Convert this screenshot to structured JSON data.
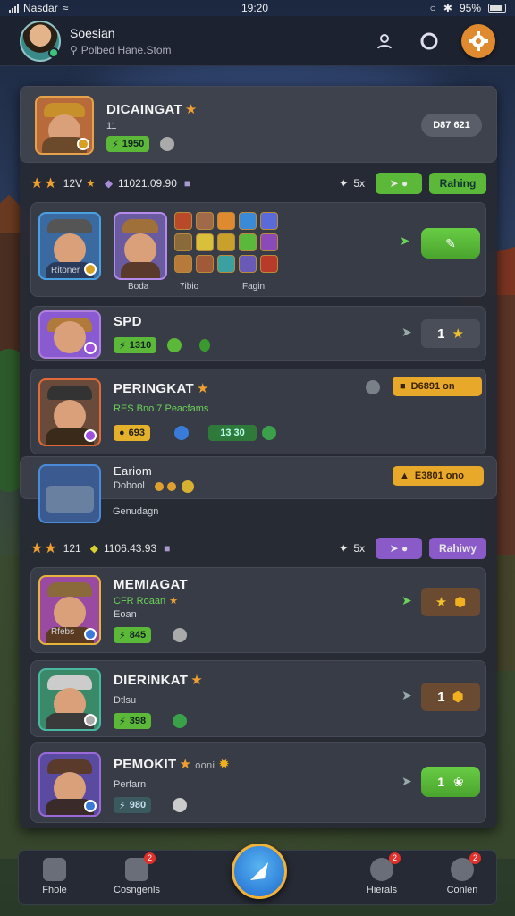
{
  "status_bar": {
    "carrier": "Nasdar",
    "time": "19:20",
    "battery": "95%"
  },
  "header": {
    "player_name": "Soesian",
    "player_sub": "Polbed Hane.Stom"
  },
  "featured": {
    "name": "DICAINGAT",
    "level": "11",
    "chip_value": "1950",
    "button_label": "D87 621"
  },
  "group1": {
    "level": "12V",
    "score": "11021.09.90",
    "rank_label": "5x",
    "action_label": "Rahing"
  },
  "team_card": {
    "hero_label": "Ritoner",
    "col_labels": [
      "Boda",
      "7ibio",
      "Fagin"
    ]
  },
  "rows": [
    {
      "name": "SPD",
      "chip_value": "1310",
      "button_count": "1"
    },
    {
      "name": "PERINGKAT",
      "sub": "RES Bno 7 Peacfams",
      "chip_value": "693",
      "chip2_value": "13 30",
      "button_label": "D6891 on"
    },
    {
      "name": "Eariom",
      "sub": "Dobool",
      "footer": "Genudagn",
      "button_label": "E3801 ono"
    }
  ],
  "group2": {
    "level": "121",
    "score": "1106.43.93",
    "rank_label": "5x",
    "action_label": "Rahiwy"
  },
  "rows2": [
    {
      "name": "MEMIAGAT",
      "sub": "CFR Roaan",
      "sub2": "Eoan",
      "hero_label": "Rfebs",
      "chip_value": "845"
    },
    {
      "name": "DIERINKAT",
      "sub": "Dtlsu",
      "chip_value": "398",
      "button_count": "1"
    },
    {
      "name": "PEMOKIT",
      "sub": "Perfarn",
      "extra": "ooni",
      "chip_value": "980",
      "button_count": "1"
    }
  ],
  "bottom_nav": {
    "items": [
      "Fhole",
      "Cosngenls",
      "Hierals",
      "Conlen"
    ],
    "badges": [
      "2",
      "2",
      "2"
    ]
  },
  "colors": {
    "accent_orange": "#e08a30",
    "green": "#5cb838",
    "panel": "#262a34"
  }
}
